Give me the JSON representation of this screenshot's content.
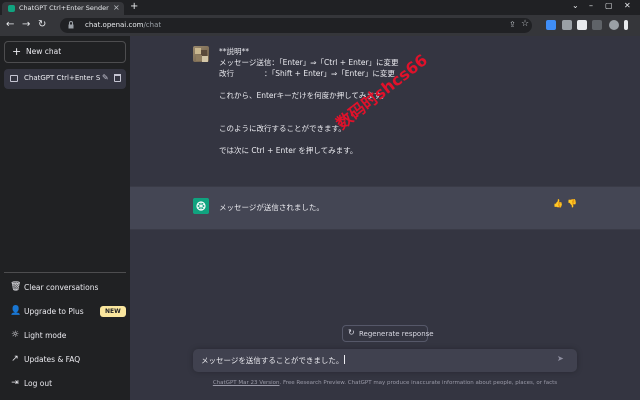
{
  "browser": {
    "tab_title": "ChatGPT Ctrl+Enter Sender",
    "tab_close": "×",
    "new_tab": "+",
    "window_controls": [
      "⌄",
      "–",
      "▢",
      "✕"
    ],
    "nav": {
      "back": "←",
      "forward": "→",
      "reload": "↻"
    },
    "url_host": "chat.openai.com",
    "url_path": "/chat",
    "extension_colors": [
      "#3f8ef7",
      "#9aa0a6",
      "#e8eaed",
      "#5f6368",
      "#9aa0a6",
      "#e8eaed",
      "#e37400",
      "#1a73e8"
    ]
  },
  "sidebar": {
    "new_chat": "New chat",
    "chats": [
      {
        "title": "ChatGPT Ctrl+Enter Sen"
      }
    ],
    "menu": [
      {
        "label": "Clear conversations",
        "icon": "trash-icon"
      },
      {
        "label": "Upgrade to Plus",
        "icon": "user-icon",
        "badge": "NEW"
      },
      {
        "label": "Light mode",
        "icon": "sun-icon"
      },
      {
        "label": "Updates & FAQ",
        "icon": "external-link-icon"
      },
      {
        "label": "Log out",
        "icon": "logout-icon"
      }
    ]
  },
  "conversation": {
    "user_message": {
      "lines": [
        "**説明**",
        "メッセージ送信：「Enter」⇒「Ctrl + Enter」に変更",
        "改行　　　　：「Shift + Enter」⇒「Enter」に変更",
        "",
        "これから、Enterキーだけを何度か押してみます。",
        "",
        "",
        "このように改行することができます。",
        "",
        "では次に Ctrl + Enter を押してみます。"
      ]
    },
    "assistant_message": {
      "text": "メッセージが送信されました。"
    }
  },
  "watermark": "数码时shcs66",
  "regenerate_label": "Regenerate response",
  "composer": {
    "value": "メッセージを送信することができました。"
  },
  "footer": {
    "link": "ChatGPT Mar 23 Version",
    "text": ". Free Research Preview. ChatGPT may produce inaccurate information about people, places, or facts"
  },
  "colors": {
    "sidebar_bg": "#202123",
    "main_bg": "#343541",
    "assistant_bg": "#444654",
    "accent": "#10a37f",
    "badge": "#fae69e",
    "watermark": "#e0112a"
  }
}
